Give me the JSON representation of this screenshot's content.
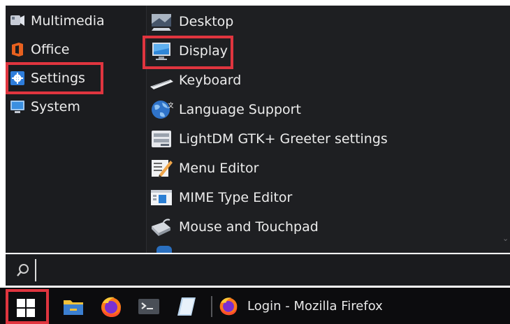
{
  "categories": [
    {
      "label": "Multimedia",
      "icon": "multimedia-icon"
    },
    {
      "label": "Office",
      "icon": "office-icon"
    },
    {
      "label": "Settings",
      "icon": "settings-gear-icon",
      "highlighted": true
    },
    {
      "label": "System",
      "icon": "system-monitor-icon"
    }
  ],
  "apps": [
    {
      "label": "Desktop",
      "icon": "desktop-icon"
    },
    {
      "label": "Display",
      "icon": "display-icon",
      "highlighted": true
    },
    {
      "label": "Keyboard",
      "icon": "keyboard-icon"
    },
    {
      "label": "Language Support",
      "icon": "language-globe-icon"
    },
    {
      "label": "LightDM GTK+ Greeter settings",
      "icon": "greeter-settings-icon"
    },
    {
      "label": "Menu Editor",
      "icon": "menu-editor-icon"
    },
    {
      "label": "MIME Type Editor",
      "icon": "mime-editor-icon"
    },
    {
      "label": "Mouse and Touchpad",
      "icon": "mouse-icon"
    }
  ],
  "search": {
    "value": "",
    "placeholder": ""
  },
  "taskbar": {
    "start_highlighted": true,
    "window_title": "Login - Mozilla Firefox"
  },
  "colors": {
    "highlight": "#e0353f",
    "menu_bg": "#1b1c1f",
    "taskbar_bg": "#0c0c0e"
  }
}
